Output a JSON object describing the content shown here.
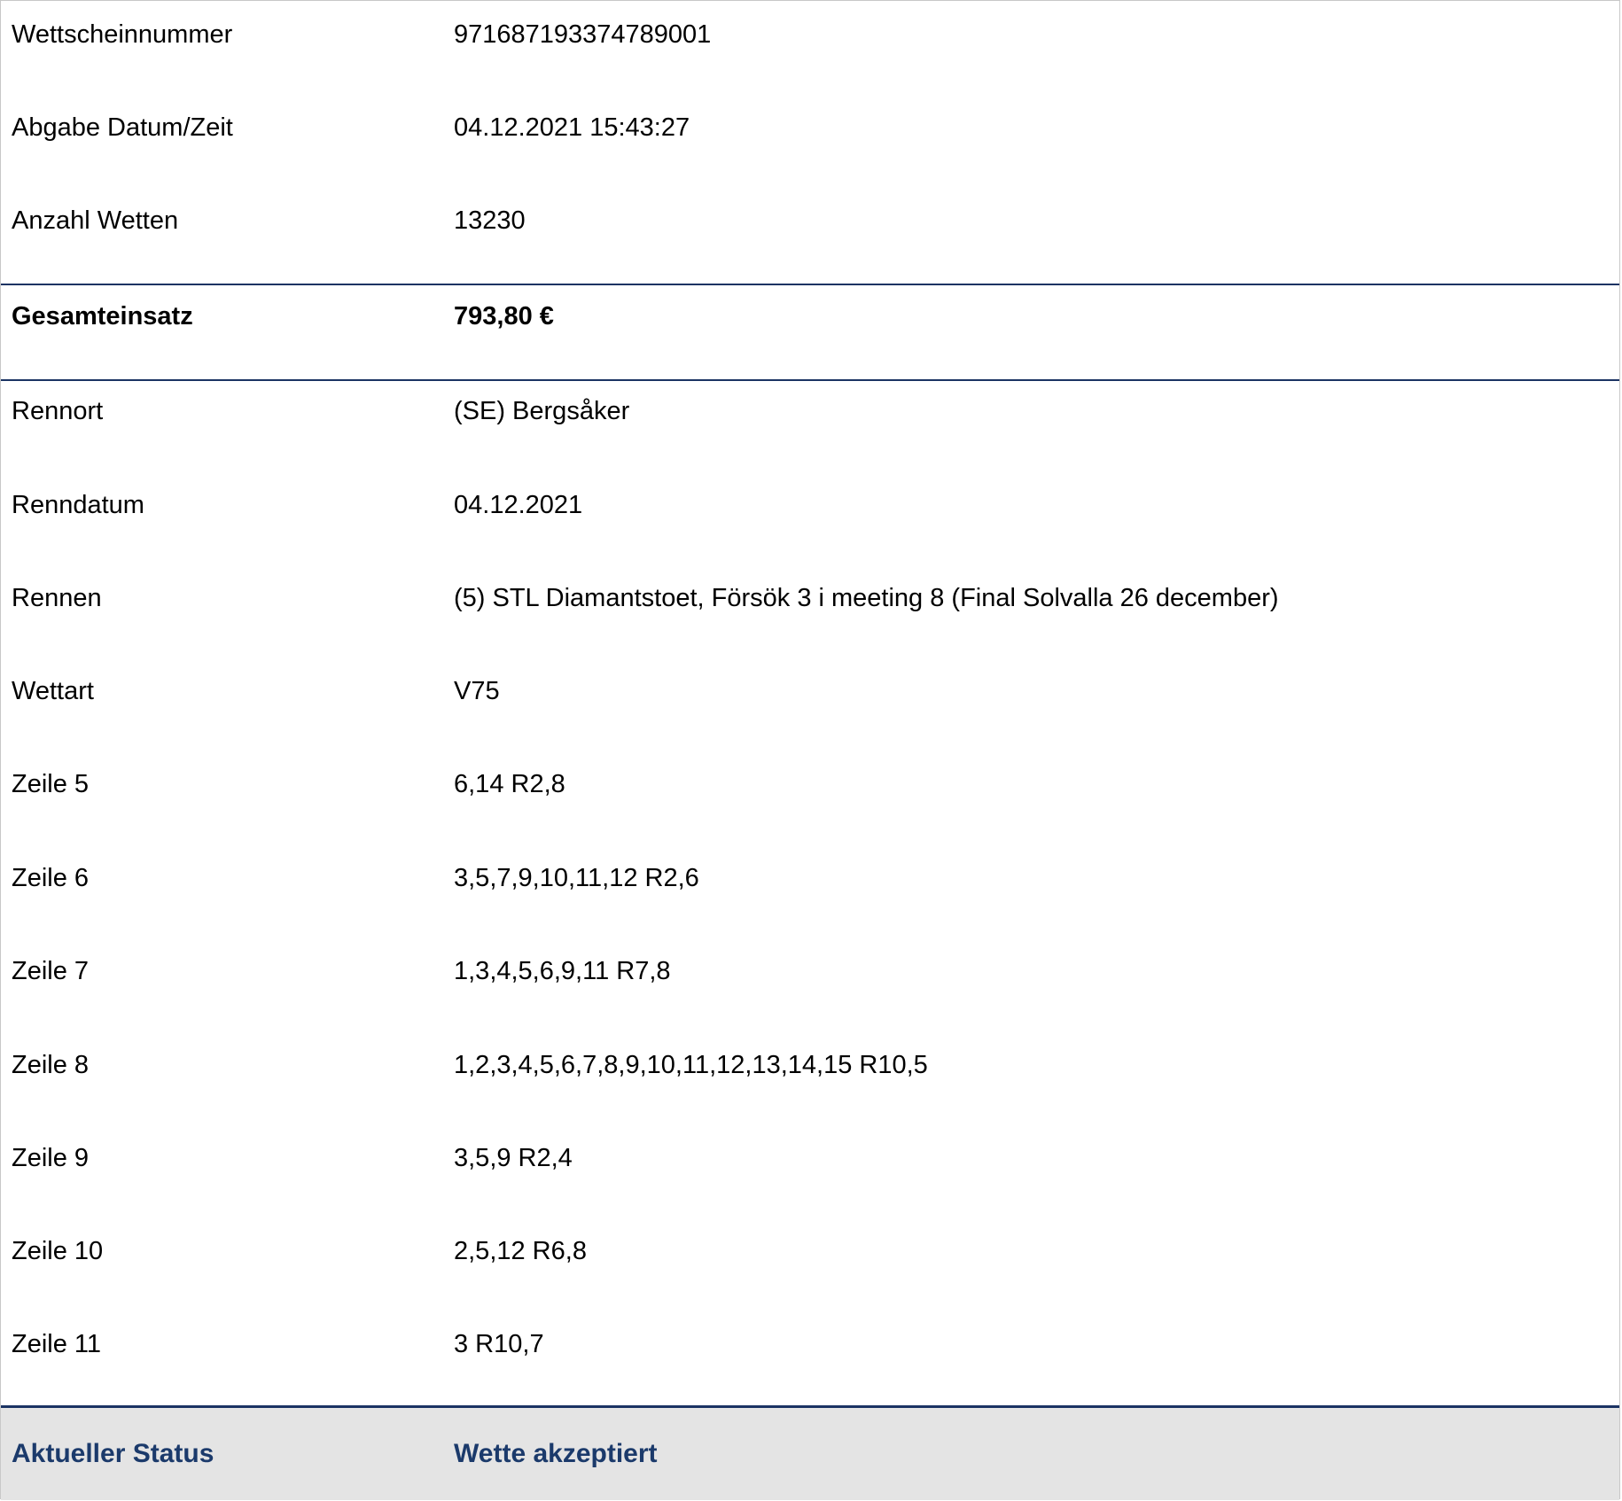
{
  "rows": [
    {
      "label": "Wettscheinnummer",
      "value": "971687193374789001"
    },
    {
      "label": "Abgabe Datum/Zeit",
      "value": "04.12.2021 15:43:27"
    },
    {
      "label": "Anzahl Wetten",
      "value": "13230"
    },
    {
      "label": "Gesamteinsatz",
      "value": "793,80 €"
    },
    {
      "label": "Rennort",
      "value": "(SE) Bergsåker"
    },
    {
      "label": "Renndatum",
      "value": "04.12.2021"
    },
    {
      "label": "Rennen",
      "value": "(5) STL Diamantstoet, Försök 3 i meeting 8 (Final Solvalla 26 december)"
    },
    {
      "label": "Wettart",
      "value": "V75"
    },
    {
      "label": "Zeile 5",
      "value": "6,14 R2,8"
    },
    {
      "label": "Zeile 6",
      "value": "3,5,7,9,10,11,12 R2,6"
    },
    {
      "label": "Zeile 7",
      "value": "1,3,4,5,6,9,11 R7,8"
    },
    {
      "label": "Zeile 8",
      "value": "1,2,3,4,5,6,7,8,9,10,11,12,13,14,15 R10,5"
    },
    {
      "label": "Zeile 9",
      "value": "3,5,9 R2,4"
    },
    {
      "label": "Zeile 10",
      "value": "2,5,12 R6,8"
    },
    {
      "label": "Zeile 11",
      "value": "3 R10,7"
    }
  ],
  "status": {
    "label": "Aktueller Status",
    "value": "Wette akzeptiert"
  },
  "colors": {
    "accent": "#1b3363",
    "status_text": "#1b3a6b",
    "status_bg": "#e4e4e4"
  }
}
